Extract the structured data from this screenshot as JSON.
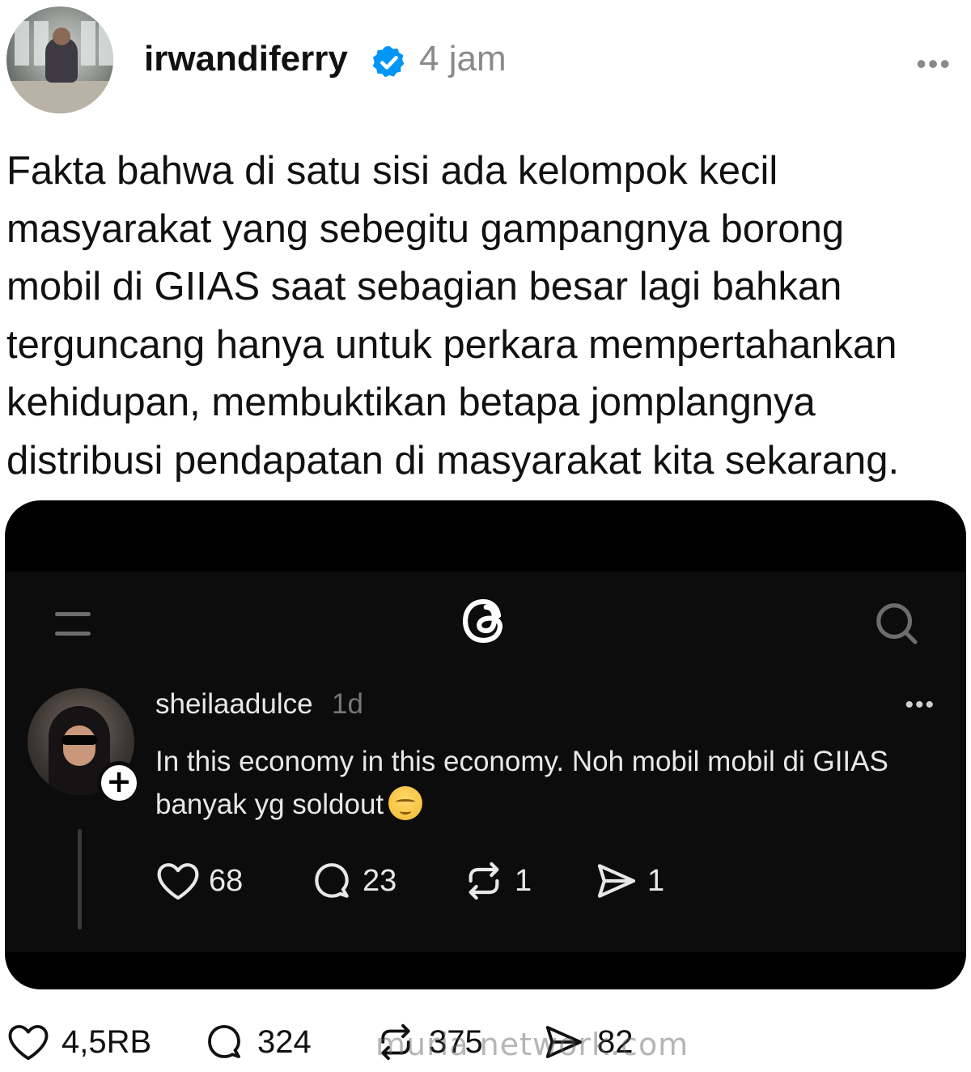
{
  "header": {
    "username": "irwandiferry",
    "verified_icon": "verified-badge-icon",
    "time": "4 jam",
    "more_icon": "more-dots-icon",
    "more_label": "•••"
  },
  "post": {
    "text": "Fakta bahwa di satu sisi ada kelompok kecil\nmasyarakat yang sebegitu gampangnya borong\nmobil di GIIAS saat sebagian besar lagi bahkan\nterguncang hanya untuk perkara mempertahankan\nkehidupan, membuktikan betapa jomplangnya\ndistribusi pendapatan di masyarakat kita sekarang."
  },
  "embed": {
    "menu_icon": "menu-icon",
    "logo_icon": "threads-logo-icon",
    "search_icon": "search-icon",
    "post": {
      "username": "sheilaadulce",
      "time": "1d",
      "more_label": "•••",
      "follow_label": "+",
      "text": "In this economy in this economy. Noh mobil mobil di GIIAS banyak yg soldout",
      "emoji_icon": "relieved-face-emoji",
      "actions": {
        "likes": "68",
        "comments": "23",
        "reposts": "1",
        "shares": "1"
      }
    }
  },
  "actions": {
    "likes": "4,5RB",
    "comments": "324",
    "reposts": "375",
    "shares": "82"
  },
  "watermark": "muria network.com",
  "colors": {
    "background": "#ffffff",
    "verified": "#0095f6",
    "embed_background": "#0c0c0c",
    "muted_text": "#8a8a8a"
  }
}
